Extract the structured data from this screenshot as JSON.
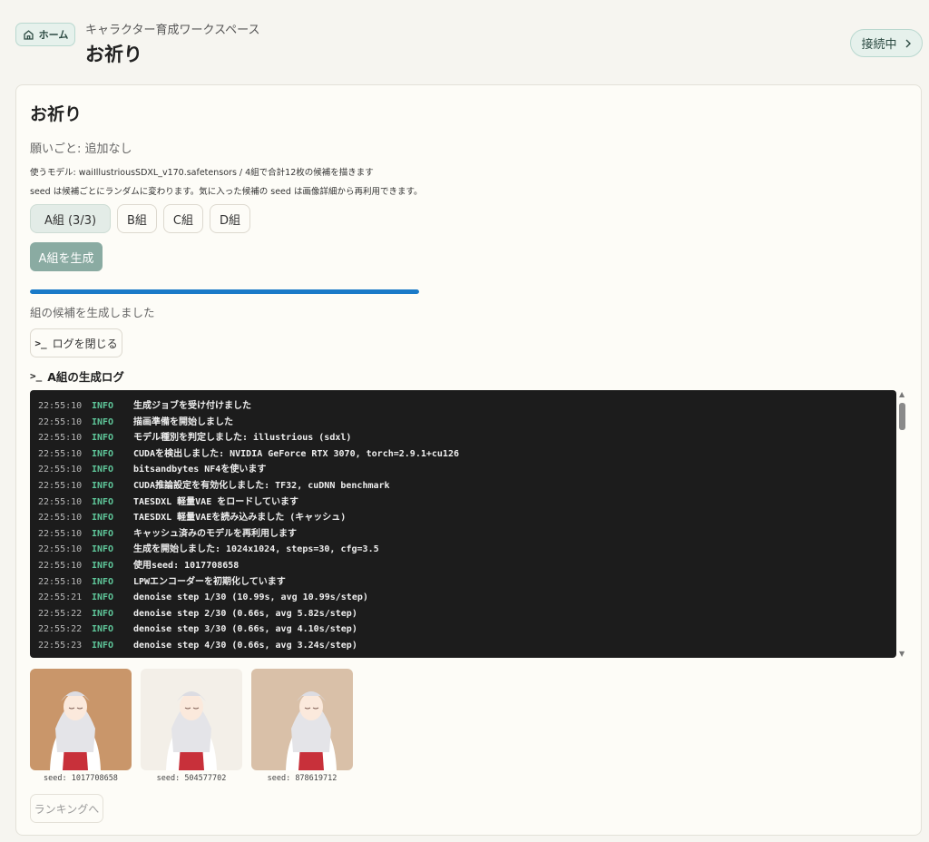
{
  "header": {
    "home_label": "ホーム",
    "workspace": "キャラクター育成ワークスペース",
    "title": "お祈り",
    "connection_label": "接続中"
  },
  "card": {
    "title": "お祈り",
    "wish": "願いごと: 追加なし",
    "model_line": "使うモデル: waiIllustriousSDXL_v170.safetensors / 4組で合計12枚の候補を描きます",
    "seed_line": "seed は候補ごとにランダムに変わります。気に入った候補の seed は画像詳細から再利用できます。",
    "tabs": [
      {
        "label": "A組 (3/3)"
      },
      {
        "label": "B組"
      },
      {
        "label": "C組"
      },
      {
        "label": "D組"
      }
    ],
    "generate_label": "A組を生成",
    "progress_fraction": 1.0,
    "status": "組の候補を生成しました",
    "close_log_label": "ログを閉じる",
    "log_title": "A組の生成ログ",
    "ranking_label": "ランキングへ"
  },
  "log": [
    {
      "time": "22:55:10",
      "level": "INFO",
      "msg": "生成ジョブを受け付けました"
    },
    {
      "time": "22:55:10",
      "level": "INFO",
      "msg": "描画準備を開始しました"
    },
    {
      "time": "22:55:10",
      "level": "INFO",
      "msg": "モデル種別を判定しました: illustrious (sdxl)"
    },
    {
      "time": "22:55:10",
      "level": "INFO",
      "msg": "CUDAを検出しました: NVIDIA GeForce RTX 3070, torch=2.9.1+cu126"
    },
    {
      "time": "22:55:10",
      "level": "INFO",
      "msg": "bitsandbytes NF4を使います"
    },
    {
      "time": "22:55:10",
      "level": "INFO",
      "msg": "CUDA推論設定を有効化しました: TF32, cuDNN benchmark"
    },
    {
      "time": "22:55:10",
      "level": "INFO",
      "msg": "TAESDXL 軽量VAE をロードしています"
    },
    {
      "time": "22:55:10",
      "level": "INFO",
      "msg": "TAESDXL 軽量VAEを読み込みました (キャッシュ)"
    },
    {
      "time": "22:55:10",
      "level": "INFO",
      "msg": "キャッシュ済みのモデルを再利用します"
    },
    {
      "time": "22:55:10",
      "level": "INFO",
      "msg": "生成を開始しました: 1024x1024, steps=30, cfg=3.5"
    },
    {
      "time": "22:55:10",
      "level": "INFO",
      "msg": "使用seed: 1017708658"
    },
    {
      "time": "22:55:10",
      "level": "INFO",
      "msg": "LPWエンコーダーを初期化しています"
    },
    {
      "time": "22:55:21",
      "level": "INFO",
      "msg": "denoise step 1/30 (10.99s, avg 10.99s/step)"
    },
    {
      "time": "22:55:22",
      "level": "INFO",
      "msg": "denoise step 2/30 (0.66s, avg 5.82s/step)"
    },
    {
      "time": "22:55:22",
      "level": "INFO",
      "msg": "denoise step 3/30 (0.66s, avg 4.10s/step)"
    },
    {
      "time": "22:55:23",
      "level": "INFO",
      "msg": "denoise step 4/30 (0.66s, avg 3.24s/step)"
    }
  ],
  "candidates": [
    {
      "seed_label": "seed: 1017708658",
      "bg": "#c9966a"
    },
    {
      "seed_label": "seed: 504577702",
      "bg": "#f3efe8"
    },
    {
      "seed_label": "seed: 878619712",
      "bg": "#d9c0a8"
    }
  ],
  "colors": {
    "accent": "#1a7ac8",
    "generate_button": "#8aaba2",
    "log_bg": "#1c1c1c",
    "log_level": "#5fc79a"
  },
  "icons": {
    "home": "home-icon",
    "chevron": "chevron-right-icon",
    "terminal": "terminal-icon"
  }
}
